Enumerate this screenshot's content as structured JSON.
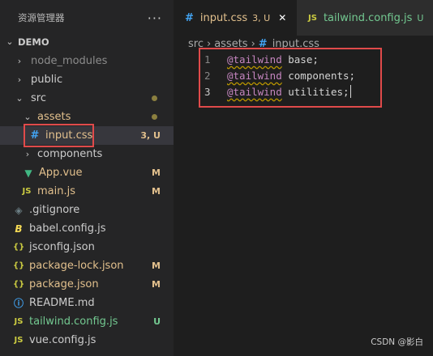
{
  "explorer": {
    "title": "资源管理器",
    "more": "···",
    "project": "DEMO",
    "items": [
      {
        "label": "node_modules",
        "status": ""
      },
      {
        "label": "public",
        "status": ""
      },
      {
        "label": "src",
        "status": ""
      },
      {
        "label": "assets",
        "status": ""
      },
      {
        "label": "input.css",
        "status": "3, U"
      },
      {
        "label": "components",
        "status": ""
      },
      {
        "label": "App.vue",
        "status": "M"
      },
      {
        "label": "main.js",
        "status": "M"
      },
      {
        "label": ".gitignore",
        "status": ""
      },
      {
        "label": "babel.config.js",
        "status": ""
      },
      {
        "label": "jsconfig.json",
        "status": ""
      },
      {
        "label": "package-lock.json",
        "status": "M"
      },
      {
        "label": "package.json",
        "status": "M"
      },
      {
        "label": "README.md",
        "status": ""
      },
      {
        "label": "tailwind.config.js",
        "status": "U"
      },
      {
        "label": "vue.config.js",
        "status": ""
      }
    ]
  },
  "tabs": [
    {
      "label": "input.css",
      "status": "3, U",
      "close": "✕"
    },
    {
      "label": "tailwind.config.js",
      "status": "U"
    }
  ],
  "breadcrumb": [
    "src",
    "assets",
    "input.css"
  ],
  "code": [
    {
      "n": "1",
      "kw": "@tailwind",
      "val": " base;"
    },
    {
      "n": "2",
      "kw": "@tailwind",
      "val": " components;"
    },
    {
      "n": "3",
      "kw": "@tailwind",
      "val": " utilities;"
    }
  ],
  "watermark": "CSDN @影白",
  "colors": {
    "modified": "#e2c08d",
    "untracked": "#73c991",
    "accent": "#e04a4a"
  }
}
